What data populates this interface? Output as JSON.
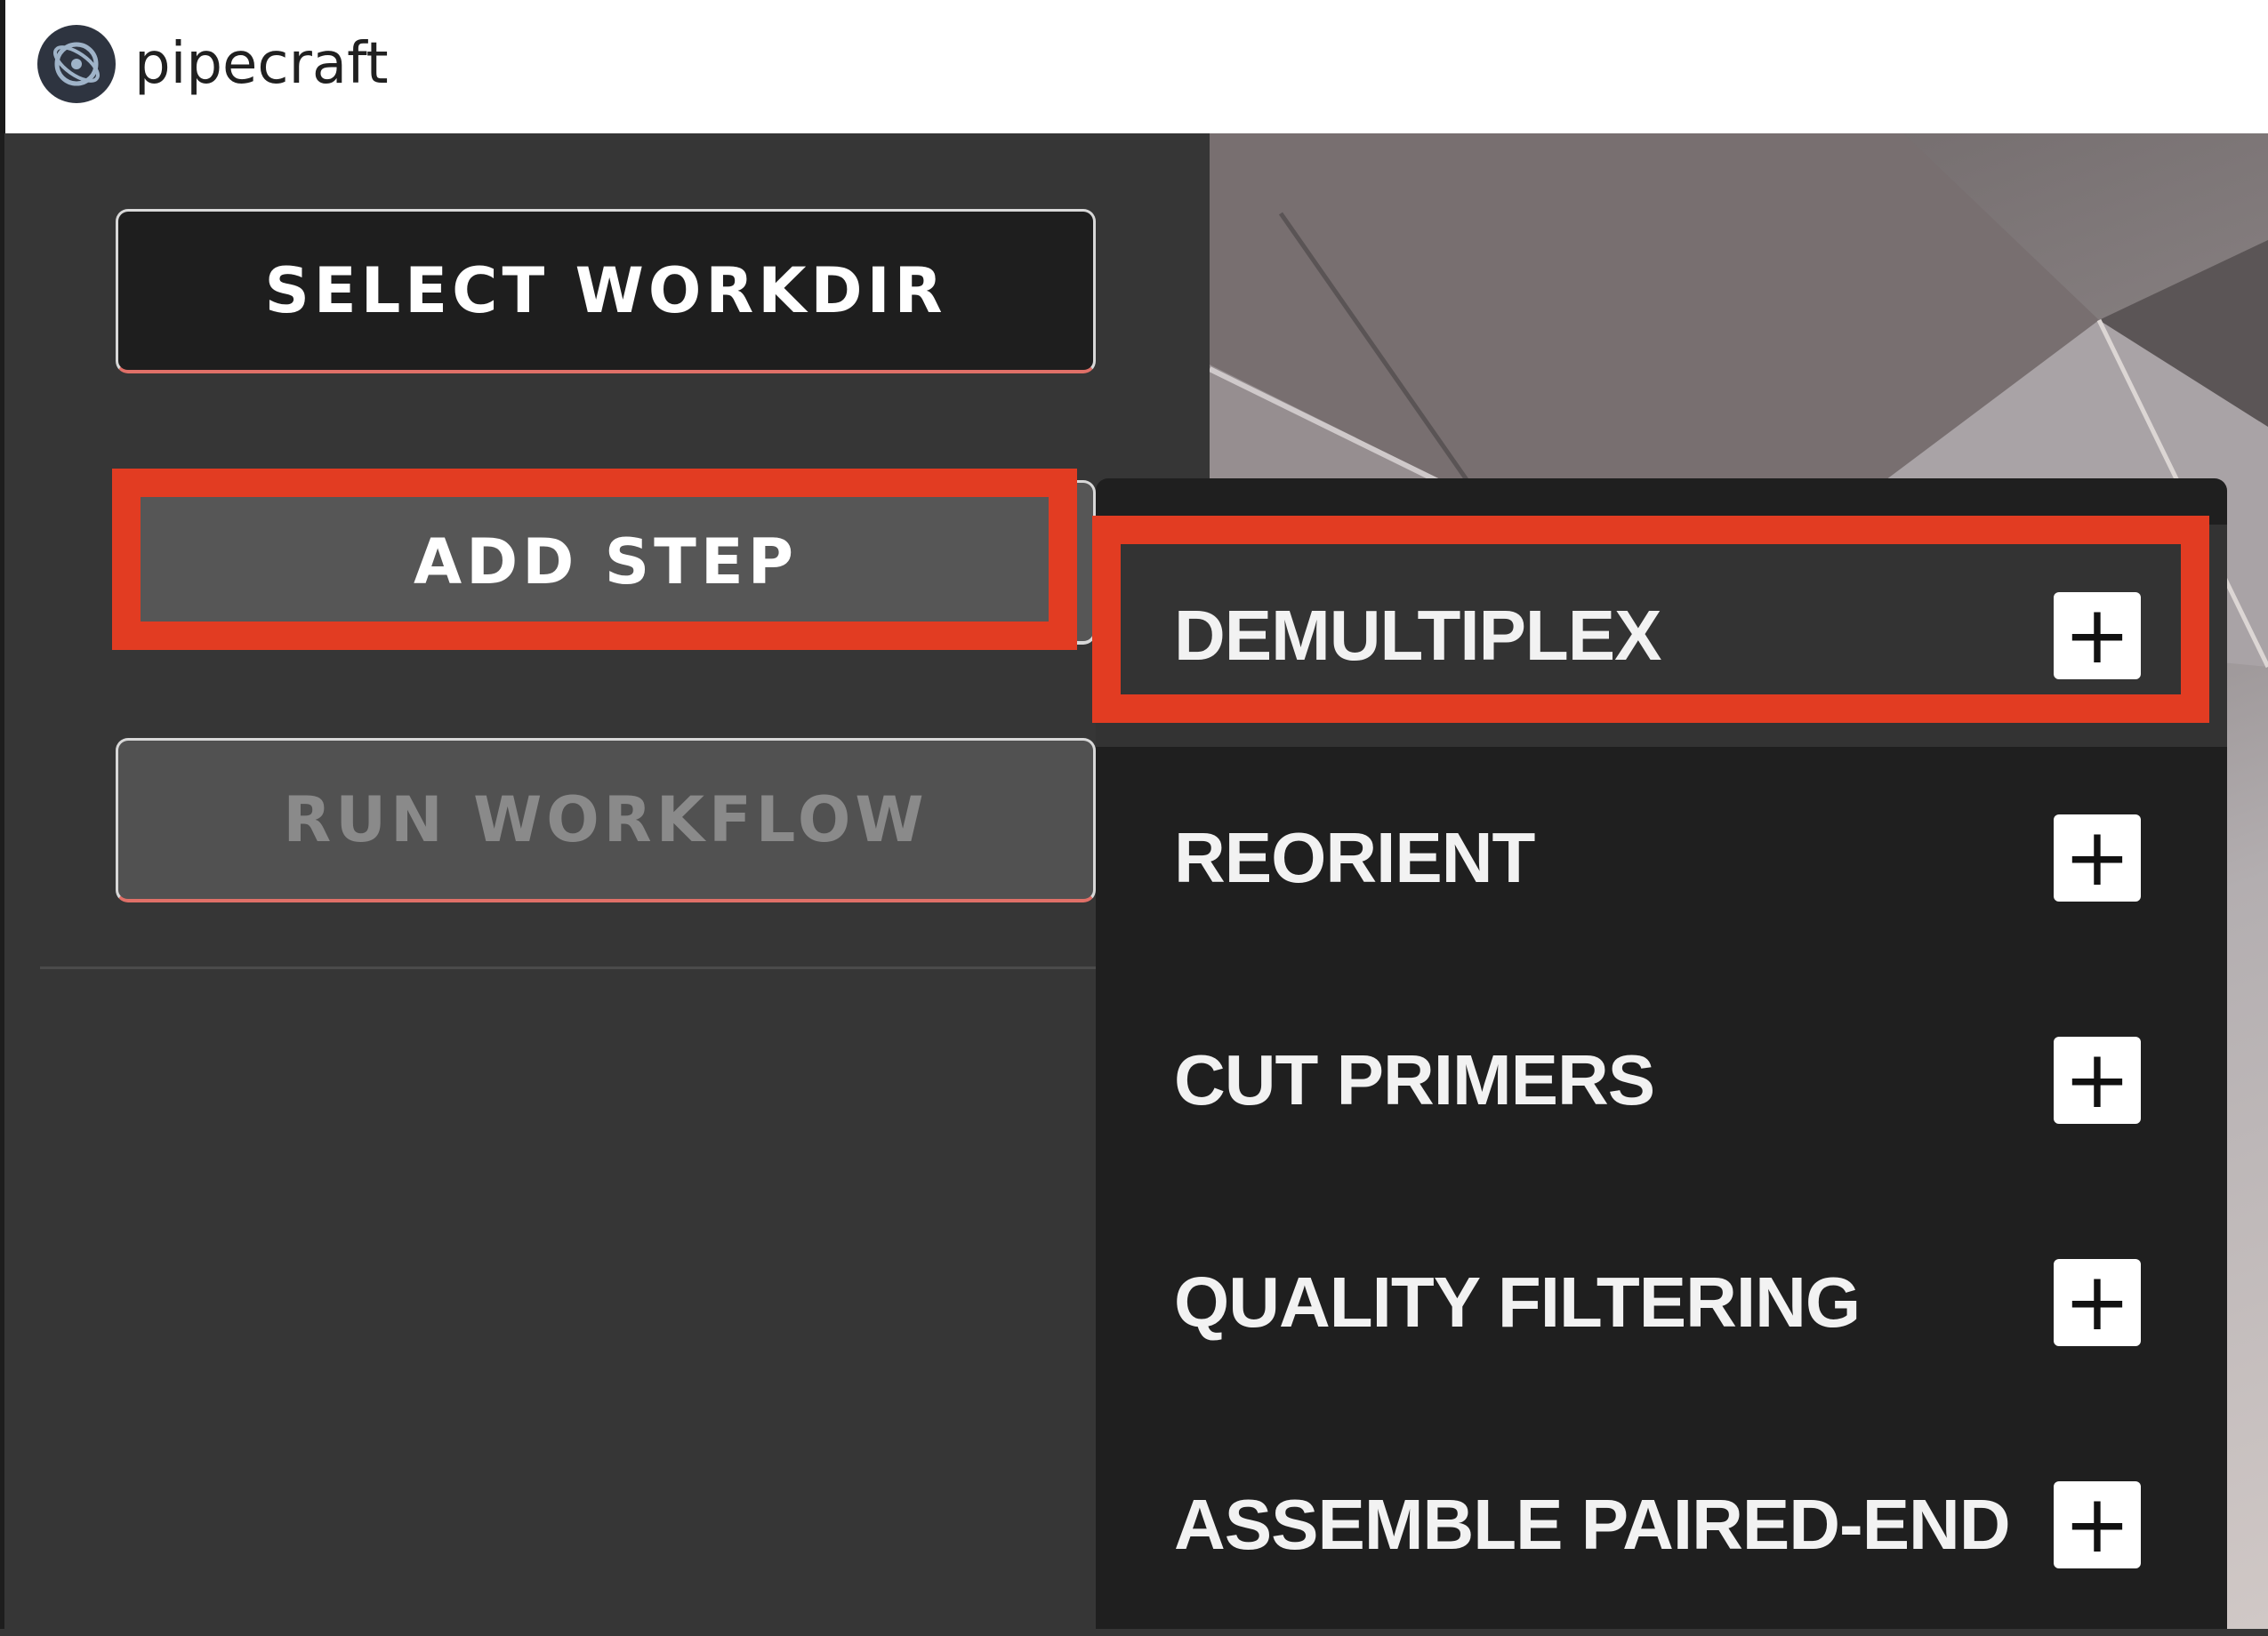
{
  "window": {
    "title": "pipecraft",
    "logo_icon": "pipecraft-logo-icon"
  },
  "sidebar": {
    "select_workdir_label": "SELECT WORKDIR",
    "add_step_label": "ADD STEP",
    "run_workflow_label": "RUN WORKFLOW"
  },
  "menu": {
    "items": [
      {
        "label": "DEMULTIPLEX",
        "icon": "plus-icon",
        "highlighted": true
      },
      {
        "label": "REORIENT",
        "icon": "plus-icon"
      },
      {
        "label": "CUT PRIMERS",
        "icon": "plus-icon"
      },
      {
        "label": "QUALITY FILTERING",
        "icon": "plus-icon"
      },
      {
        "label": "ASSEMBLE PAIRED-END",
        "icon": "plus-icon"
      }
    ]
  },
  "colors": {
    "panel": "#363636",
    "menu_bg": "#1f1f1f",
    "highlight": "#e23c22",
    "button_accent_border": "#e07068"
  }
}
